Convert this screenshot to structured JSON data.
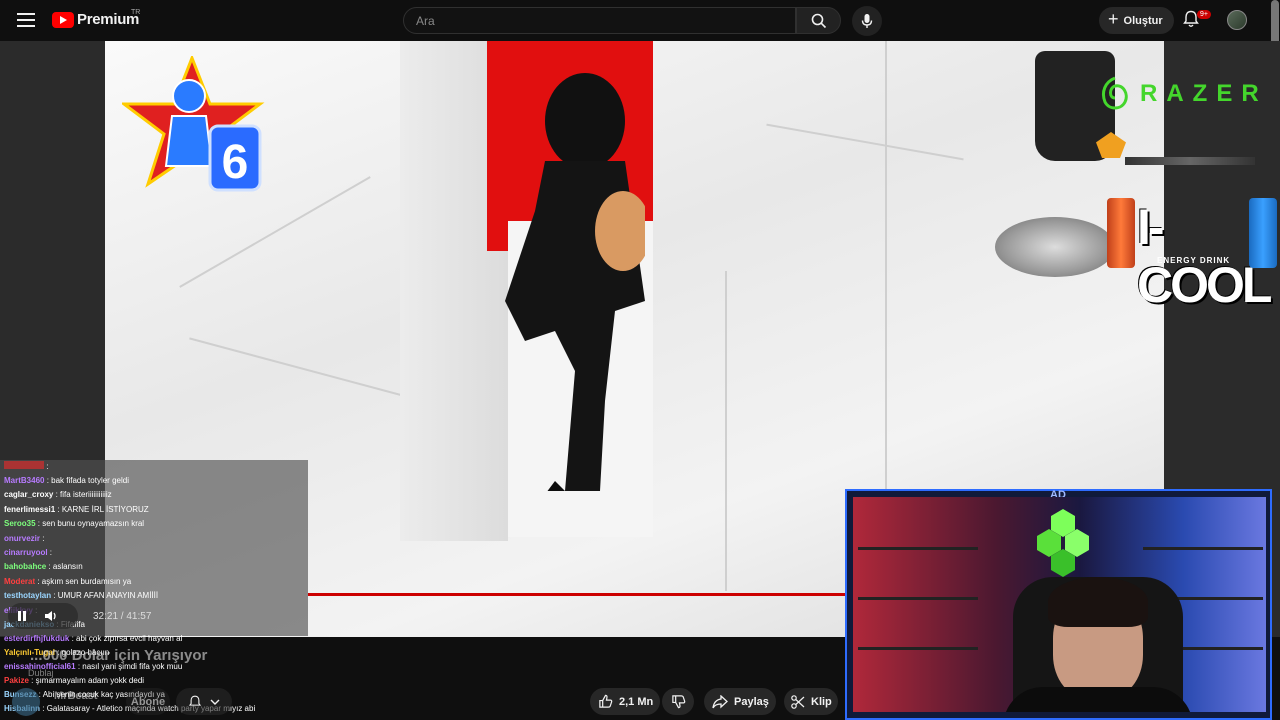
{
  "header": {
    "menu_icon": "hamburger-icon",
    "logo_text": "Premium",
    "logo_country": "TR",
    "search_placeholder": "Ara",
    "create_label": "Oluştur",
    "notification_badge": "9+"
  },
  "video": {
    "time_current": "32:21",
    "time_total": "41:57",
    "time_display": "32:21 / 41:57",
    "progress": 0.771,
    "title": "...000 Dolar için Yarışıyor",
    "overlay_sponsor_1": "RAZER",
    "overlay_sponsor_2": "I-COOL",
    "overlay_sponsor_2_sub": "ENERGY DRINK",
    "overlay_sponsor_can": "I-COOL",
    "overlay_badge_number": "6",
    "bg_accent_color": "#e10f0f"
  },
  "actions": {
    "like_count": "2,1 Mn",
    "share_label": "Paylaş",
    "clip_label": "Klip",
    "subscribe_label": "Abone",
    "channel_name": "MrBeast",
    "dub_label": "Dublaj"
  },
  "chat": [
    {
      "user": "bak fifada totyler geldi",
      "name": "MartB3460",
      "color": "#b77bff"
    },
    {
      "name": "caglar_croxy",
      "user": "fifa isteriiiiiiiiiiiz",
      "color": "#ffffff"
    },
    {
      "name": "fenerlimessi1",
      "user": "KARNE İRL İSTİYORUZ",
      "color": "#ffffff"
    },
    {
      "name": "Seroo35",
      "user": "sen bunu oynayamazsın kral",
      "color": "#7dff7d"
    },
    {
      "name": "onurvezir",
      "user": "",
      "color": "#b77bff"
    },
    {
      "name": "cinarruyool",
      "user": "",
      "color": "#b77bff"
    },
    {
      "name": "bahobahce",
      "user": "aslansın",
      "color": "#7dff7d"
    },
    {
      "name": "Moderat",
      "user": "aşkım sen burdamısın ya",
      "color": "#ff4040"
    },
    {
      "name": "testhotaylan",
      "user": "UMUR AFAN ANAYIN AMİİİİ",
      "color": "#9bd6ff"
    },
    {
      "name": "eliikkyy",
      "user": "",
      "color": "#b77bff"
    },
    {
      "name": "jackdaniekso",
      "user": "Fifafifa",
      "color": "#9bd6ff"
    }
  ],
  "chat_lower": [
    {
      "name": "esterdirfhjfukduk",
      "user": "abi çok zıpırsa evcil hayvan al",
      "color": "#b77bff"
    },
    {
      "name": "Yalçınlı-Tugal",
      "user": "golazo hacıın",
      "color": "#ffcc33"
    },
    {
      "name": "enissahinofficial61",
      "user": "nasıl yani şimdi fifa yok muu",
      "color": "#b77bff"
    },
    {
      "name": "Pakize",
      "user": "şımarmayalım adam yokk dedi",
      "color": "#ff4040"
    },
    {
      "name": "Bunsezz",
      "user": "Abi senin cocuk kaç yasındaydı ya",
      "color": "#9bd6ff"
    },
    {
      "name": "Hisbalinn",
      "user": "Galatasaray - Atletico maçında watch party yapar mıyız abi",
      "color": "#9bd6ff"
    }
  ],
  "webcam": {
    "logo_text": "AD"
  }
}
